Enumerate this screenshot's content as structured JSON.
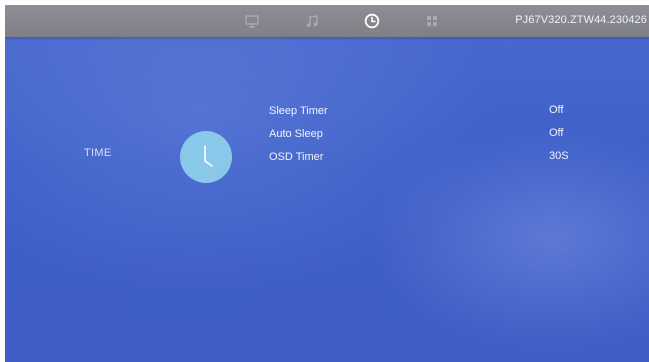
{
  "colors": {
    "top_bar": "#86878d",
    "background": "#4263cb",
    "clock_badge": "#8ac8ea",
    "text": "#f2f4fb",
    "tab_inactive": "#a9aab0",
    "tab_active": "#ffffff"
  },
  "header": {
    "tabs": [
      {
        "icon": "picture-icon",
        "active": false
      },
      {
        "icon": "music-note-icon",
        "active": false
      },
      {
        "icon": "clock-icon",
        "active": true
      },
      {
        "icon": "apps-grid-icon",
        "active": false
      }
    ],
    "version": "PJ67V320.ZTW44.230426"
  },
  "section": {
    "title": "TIME",
    "icon": "clock-icon"
  },
  "menu": {
    "items": [
      {
        "label": "Sleep Timer",
        "value": "Off"
      },
      {
        "label": "Auto Sleep",
        "value": "Off"
      },
      {
        "label": "OSD Timer",
        "value": "30S"
      }
    ]
  }
}
